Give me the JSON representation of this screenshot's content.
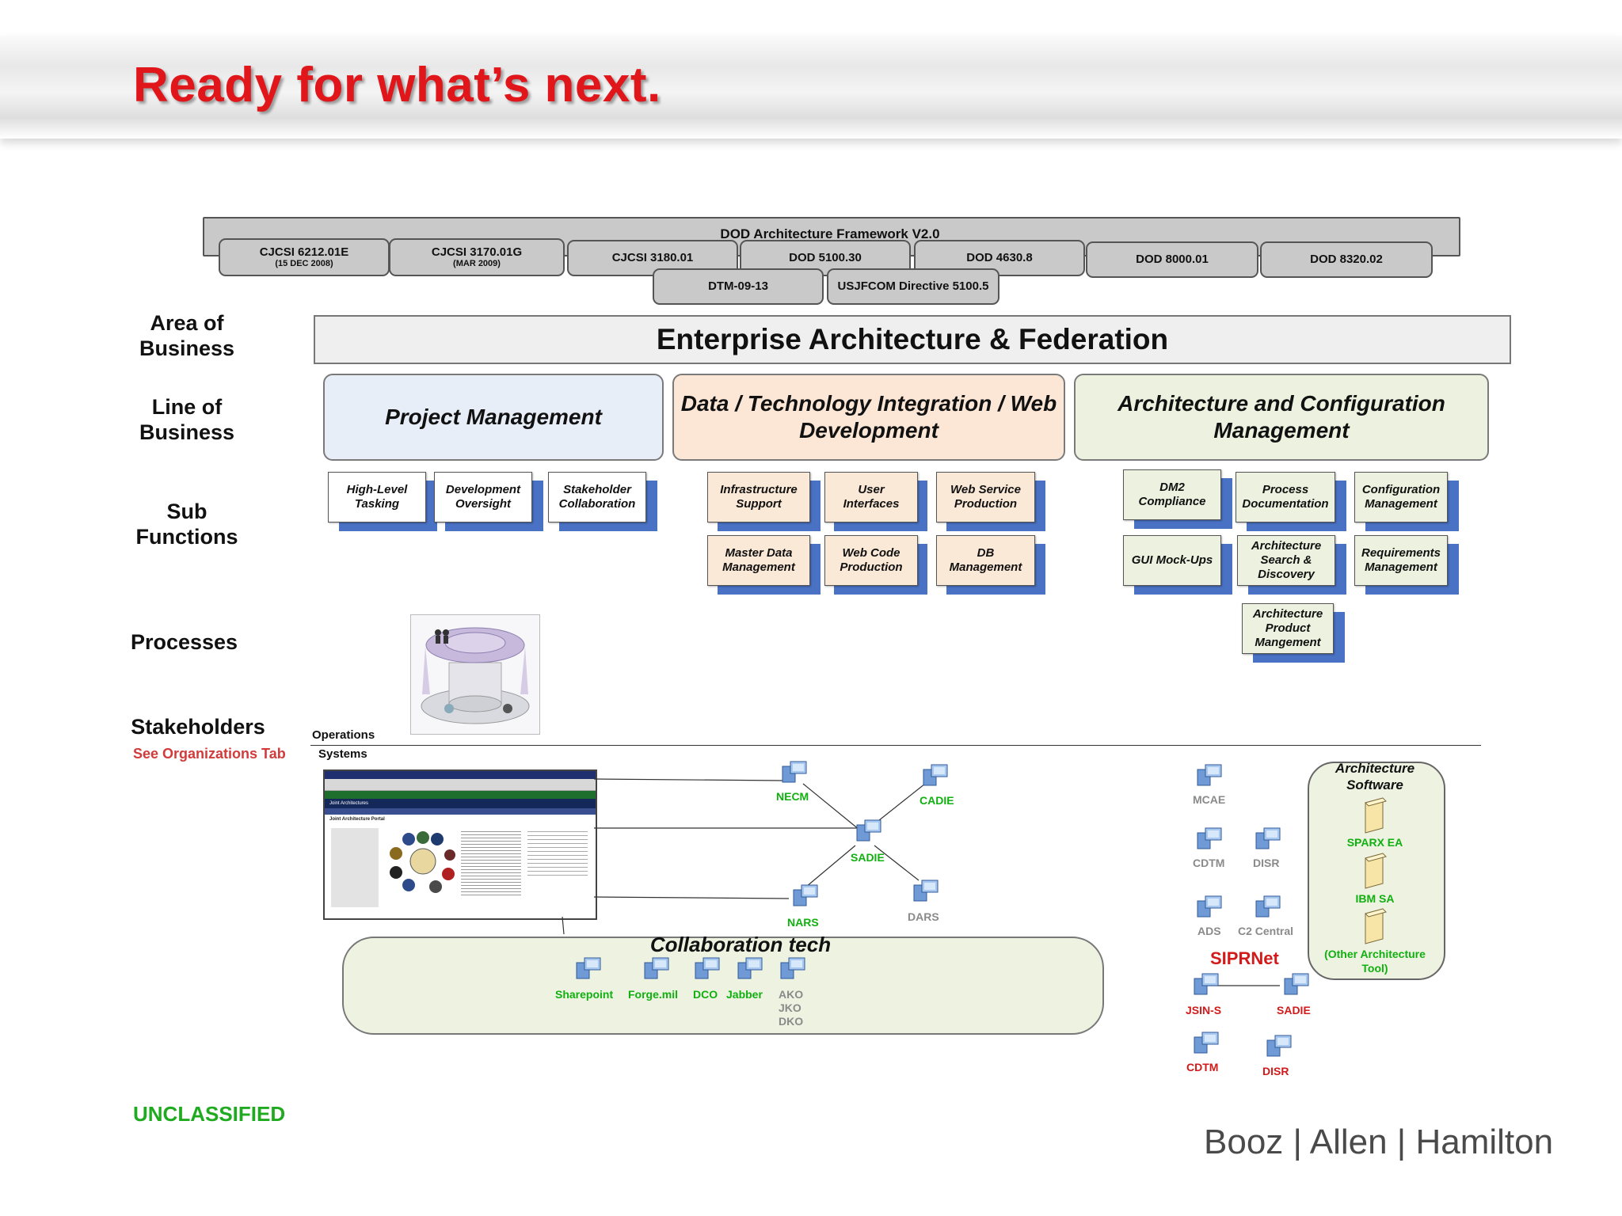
{
  "header": {
    "title": "Ready for what’s next."
  },
  "framework": {
    "title": "DOD Architecture Framework V2.0",
    "standards": [
      {
        "main": "CJCSI 6212.01E",
        "sub": "(15 DEC 2008)"
      },
      {
        "main": "CJCSI 3170.01G",
        "sub": "(MAR 2009)"
      },
      {
        "main": "CJCSI 3180.01",
        "sub": ""
      },
      {
        "main": "DOD 5100.30",
        "sub": ""
      },
      {
        "main": "DOD 4630.8",
        "sub": ""
      },
      {
        "main": "DOD 8000.01",
        "sub": ""
      },
      {
        "main": "DOD 8320.02",
        "sub": ""
      },
      {
        "main": "DTM-09-13",
        "sub": ""
      },
      {
        "main": "USJFCOM Directive 5100.5",
        "sub": ""
      }
    ]
  },
  "row_labels": {
    "area": "Area of Business",
    "line": "Line of Business",
    "sub": "Sub Functions",
    "processes": "Processes",
    "stakeholders": "Stakeholders",
    "see_orgs": "See Organizations Tab"
  },
  "area_of_business": "Enterprise Architecture & Federation",
  "lines_of_business": [
    "Project Management",
    "Data / Technology Integration / Web Development",
    "Architecture and Configuration Management"
  ],
  "sub_functions": {
    "pm": [
      "High-Level Tasking",
      "Development Oversight",
      "Stakeholder Collaboration"
    ],
    "dt": [
      "Infrastructure Support",
      "User Interfaces",
      "Web Service Production",
      "Master Data Management",
      "Web Code Production",
      "DB Management"
    ],
    "ac": [
      "DM2 Compliance",
      "Process Documentation",
      "Configuration Management",
      "GUI Mock-Ups",
      "Architecture Search & Discovery",
      "Requirements Management",
      "Architecture Product Mangement"
    ]
  },
  "divider": {
    "operations": "Operations",
    "systems": "Systems"
  },
  "systems_net": {
    "necm": "NECM",
    "cadie": "CADIE",
    "sadie": "SADIE",
    "nars": "NARS",
    "dars": "DARS"
  },
  "collab": {
    "title": "Collaboration tech",
    "items": [
      "Sharepoint",
      "Forge.mil",
      "DCO",
      "Jabber"
    ],
    "ako": [
      "AKO",
      "JKO",
      "DKO"
    ]
  },
  "unclass_net": {
    "mcae": "MCAE",
    "cdtm": "CDTM",
    "disr": "DISR",
    "ads": "ADS",
    "c2central": "C2 Central"
  },
  "siprnet": {
    "title": "SIPRNet",
    "jsins": "JSIN-S",
    "sadie": "SADIE",
    "cdtm": "CDTM",
    "disr": "DISR"
  },
  "arch_software": {
    "title": "Architecture Software",
    "items": [
      "SPARX EA",
      "IBM SA",
      "(Other Architecture Tool)"
    ]
  },
  "portal": {
    "title": "Joint Architecture Portal",
    "nav": "Joint Architectures"
  },
  "footer": {
    "classification": "UNCLASSIFIED",
    "logo": "Booz | Allen | Hamilton"
  },
  "colors": {
    "title_red": "#e0161b",
    "unclass_green": "#1faa1f",
    "shadow_blue": "#4a72c4",
    "pm_fill": "#e8eef7",
    "dt_fill": "#fce7d6",
    "ac_fill": "#edf1df",
    "siprnet_red": "#d21a1a"
  }
}
